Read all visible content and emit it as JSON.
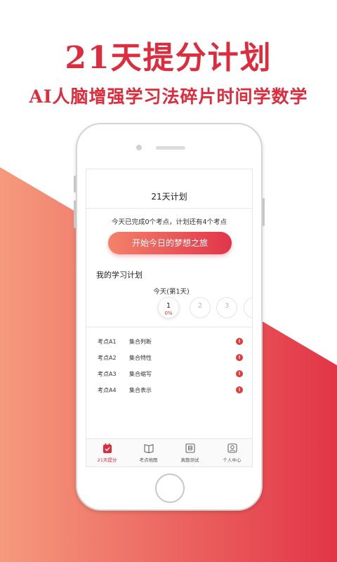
{
  "headline": {
    "title": "21天提分计划",
    "subtitle": "AI人脑增强学习法碎片时间学数学"
  },
  "colors": {
    "accent": "#e02b3c",
    "gradient_start": "#f3826a",
    "gradient_end": "#e1354a",
    "alert": "#e53a3a"
  },
  "app": {
    "title": "21天计划",
    "progress_text": "今天已完成0个考点，计划还有4个考点",
    "start_button": "开始今日的梦想之旅",
    "plan_label": "我的学习计划",
    "today_label": "今天(第1天)",
    "days": [
      {
        "num": "1",
        "percent": "0%",
        "active": true
      },
      {
        "num": "2",
        "active": false
      },
      {
        "num": "3",
        "active": false
      }
    ],
    "points": [
      {
        "point": "考点A1",
        "name": "集合判断",
        "icon": "alert-icon"
      },
      {
        "point": "考点A2",
        "name": "集合特性",
        "icon": "alert-icon"
      },
      {
        "point": "考点A3",
        "name": "集合缩写",
        "icon": "alert-icon"
      },
      {
        "point": "考点A4",
        "name": "集合表示",
        "icon": "alert-icon"
      }
    ],
    "tabs": [
      {
        "label": "21天提分",
        "icon": "calendar-check-icon",
        "active": true
      },
      {
        "label": "考点地图",
        "icon": "book-icon",
        "active": false
      },
      {
        "label": "真题测试",
        "icon": "exam-icon",
        "active": false
      },
      {
        "label": "个人中心",
        "icon": "user-icon",
        "active": false
      }
    ]
  }
}
